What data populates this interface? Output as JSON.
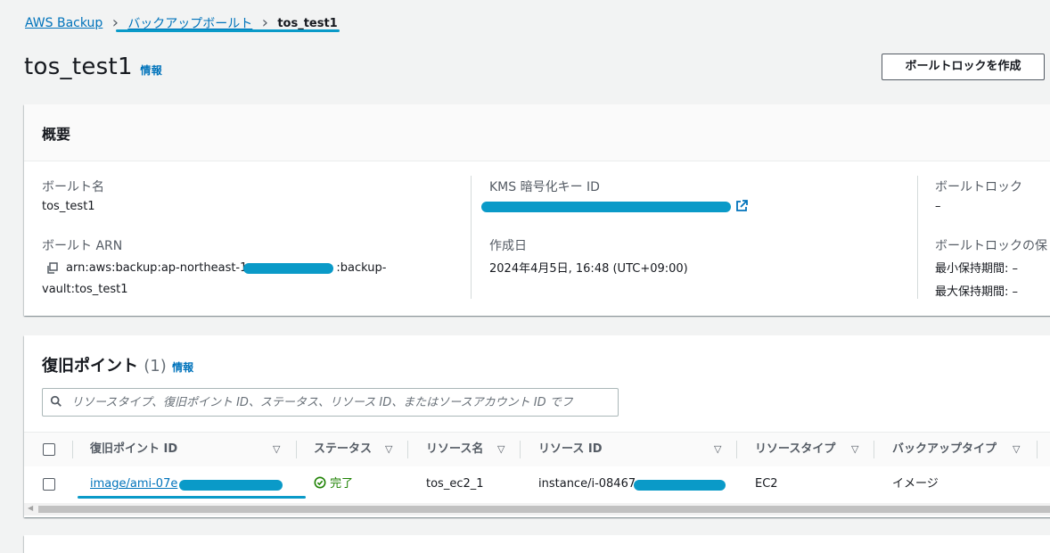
{
  "breadcrumb": {
    "root": "AWS Backup",
    "vaults": "バックアップボールト",
    "current": "tos_test1"
  },
  "page": {
    "title": "tos_test1",
    "info": "情報",
    "create_lock_button": "ボールトロックを作成"
  },
  "summary": {
    "heading": "概要",
    "vault_name_label": "ボールト名",
    "vault_name_value": "tos_test1",
    "vault_arn_label": "ボールト ARN",
    "vault_arn_prefix": "arn:aws:backup:ap-northeast-1",
    "vault_arn_suffix": ":backup-",
    "vault_arn_line2": "vault:tos_test1",
    "kms_label": "KMS 暗号化キー ID",
    "created_label": "作成日",
    "created_value": "2024年4月5日, 16:48 (UTC+09:00)",
    "vault_lock_label": "ボールトロック",
    "vault_lock_value": "–",
    "vault_lock_retention_label": "ボールトロックの保",
    "min_retention": "最小保持期間: –",
    "max_retention": "最大保持期間: –"
  },
  "recovery_points": {
    "heading": "復旧ポイント",
    "count": "(1)",
    "info": "情報",
    "search_placeholder": "リソースタイプ、復旧ポイント ID、ステータス、リソース ID、またはソースアカウント ID でフ",
    "columns": [
      "復旧ポイント ID",
      "ステータス",
      "リソース名",
      "リソース ID",
      "リソースタイプ",
      "バックアップタイプ"
    ],
    "rows": [
      {
        "id": "image/ami-07e",
        "status": "完了",
        "resource_name": "tos_ec2_1",
        "resource_id": "instance/i-08467",
        "resource_type": "EC2",
        "backup_type": "イメージ"
      }
    ]
  },
  "colors": {
    "link": "#0073bb",
    "redaction": "#0a9ac8",
    "success": "#1d8102"
  },
  "icons": {
    "breadcrumb_separator": "chevron-right-icon",
    "external_link": "external-link-icon",
    "copy": "copy-icon",
    "search": "search-icon",
    "sort": "sort-down-icon",
    "status": "check-circle-icon"
  }
}
